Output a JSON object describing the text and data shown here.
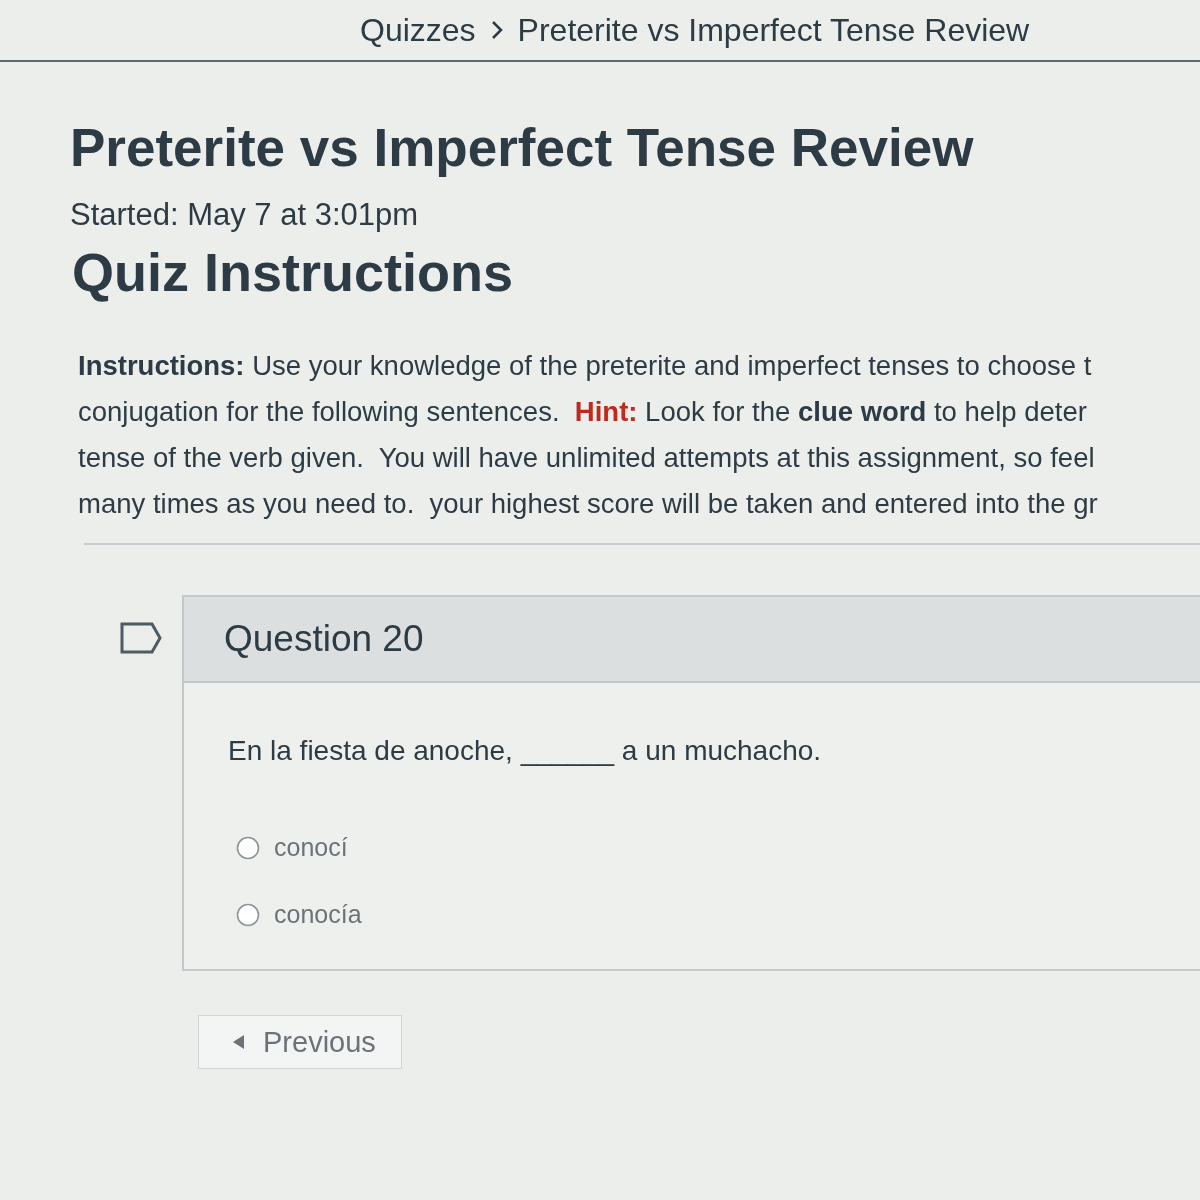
{
  "breadcrumb": [
    {
      "label": "Quizzes"
    },
    {
      "label": "Preterite vs Imperfect Tense Review"
    }
  ],
  "title": "Preterite vs Imperfect Tense Review",
  "started": "Started: May 7 at 3:01pm",
  "instructions_heading": "Quiz Instructions",
  "instructions": {
    "lines": [
      [
        {
          "kind": "label",
          "text": "Instructions:"
        },
        {
          "kind": "text",
          "text": " Use your knowledge of the preterite and imperfect tenses to choose t"
        }
      ],
      [
        {
          "kind": "text",
          "text": "conjugation for the following sentences.  "
        },
        {
          "kind": "hint",
          "text": "Hint:"
        },
        {
          "kind": "text",
          "text": " Look for the "
        },
        {
          "kind": "strong",
          "text": "clue word"
        },
        {
          "kind": "text",
          "text": " to help deter"
        }
      ],
      [
        {
          "kind": "text",
          "text": "tense of the verb given.  You will have unlimited attempts at this assignment, so feel"
        }
      ],
      [
        {
          "kind": "text",
          "text": "many times as you need to.  your highest score will be taken and entered into the gr"
        }
      ]
    ]
  },
  "question": {
    "flagged": false,
    "title": "Question 20",
    "prompt": "En la fiesta de anoche, ______ a un muchacho.",
    "options": [
      {
        "label": "conocí",
        "selected": false
      },
      {
        "label": "conocía",
        "selected": false
      }
    ]
  },
  "navigation": {
    "previous": "Previous"
  }
}
